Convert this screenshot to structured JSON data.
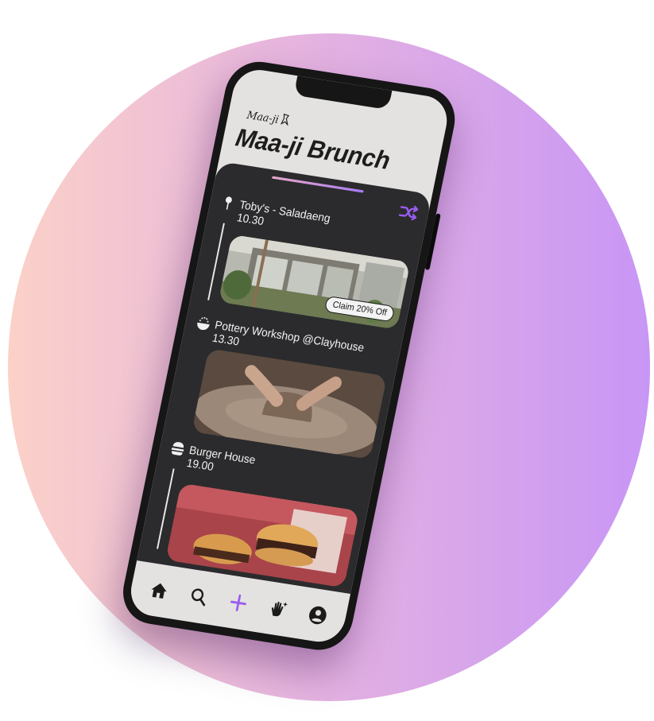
{
  "app": {
    "logo_text": "Maa-ji",
    "title": "Maa-ji Brunch"
  },
  "stops": [
    {
      "name": "Toby's - Saladaeng",
      "time": "10.30",
      "icon": "pin-icon",
      "badge": "Claim 20% Off"
    },
    {
      "name": "Pottery Workshop @Clayhouse",
      "time": "13.30",
      "icon": "dish-icon"
    },
    {
      "name": "Burger House",
      "time": "19.00",
      "icon": "burger-icon"
    }
  ],
  "nav": [
    {
      "icon": "home-icon",
      "active": true
    },
    {
      "icon": "search-icon",
      "active": false
    },
    {
      "icon": "plus-icon",
      "active": false
    },
    {
      "icon": "sparkle-hand-icon",
      "active": false
    },
    {
      "icon": "profile-icon",
      "active": false
    }
  ],
  "colors": {
    "accent": "#9a5cf0",
    "panel": "#2b2b2d",
    "screen_bg": "#e3e2e0"
  }
}
